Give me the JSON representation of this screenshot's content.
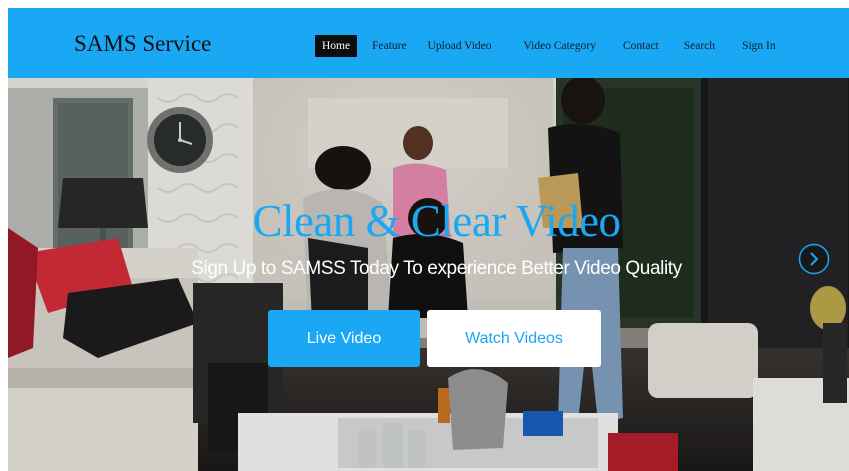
{
  "brand": "SAMS Service",
  "nav": {
    "items": [
      {
        "label": "Home",
        "active": true
      },
      {
        "label": "Feature",
        "active": false
      },
      {
        "label": "Upload Video",
        "active": false
      },
      {
        "label": "Video Category",
        "active": false
      },
      {
        "label": "Contact",
        "active": false
      },
      {
        "label": "Search",
        "active": false
      },
      {
        "label": "Sign In",
        "active": false
      }
    ]
  },
  "hero": {
    "title": "Clean & Clear Video",
    "subtitle": "Sign Up to SAMSS Today To experience Better Video Quality",
    "primary_button": "Live Video",
    "secondary_button": "Watch Videos",
    "next_icon": "chevron-right-circle-icon"
  },
  "colors": {
    "accent": "#1aa7f3",
    "nav_active_bg": "#0d0d0d",
    "text_dark": "#111111"
  }
}
